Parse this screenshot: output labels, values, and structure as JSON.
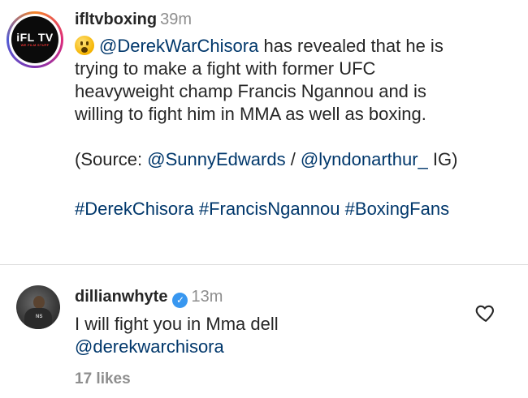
{
  "post": {
    "username": "ifltvboxing",
    "time": "39m",
    "avatar_logo": "iFL TV",
    "avatar_sub": "WE FILM STUFF",
    "caption": {
      "mention": "@DerekWarChisora",
      "line1_rest": " has revealed that he is",
      "line2": "trying to make a fight with former UFC",
      "line3": "heavyweight champ Francis Ngannou and is",
      "line4": "willing to fight him in MMA as well as boxing.",
      "source_prefix": "(Source: ",
      "source_mention1": "@SunnyEdwards",
      "source_sep": " / ",
      "source_mention2": "@lyndonarthur_",
      "source_suffix": " IG)",
      "hashtags": [
        "#DerekChisora",
        "#FrancisNgannou",
        "#BoxingFans"
      ]
    }
  },
  "comment": {
    "username": "dillianwhyte",
    "verified": true,
    "time": "13m",
    "text_line1": "I will fight you in Mma dell",
    "mention": "@derekwarchisora",
    "likes": "17 likes",
    "avatar_text": "NS"
  },
  "icons": {
    "emoji": "astonished-face-emoji",
    "verified": "verified-badge-icon",
    "like": "heart-outline-icon"
  },
  "colors": {
    "link": "#00376b",
    "muted": "#8e8e8e",
    "verified": "#3897f0"
  }
}
